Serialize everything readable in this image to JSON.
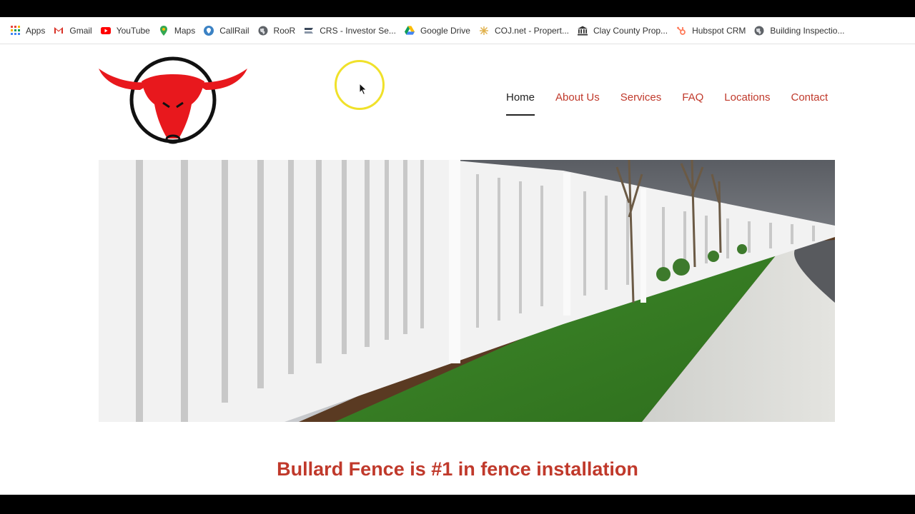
{
  "bookmarks": [
    {
      "label": "Apps",
      "icon": "apps-grid-icon"
    },
    {
      "label": "Gmail",
      "icon": "gmail-icon"
    },
    {
      "label": "YouTube",
      "icon": "youtube-icon"
    },
    {
      "label": "Maps",
      "icon": "maps-pin-icon"
    },
    {
      "label": "CallRail",
      "icon": "callrail-icon"
    },
    {
      "label": "RooR",
      "icon": "globe-icon"
    },
    {
      "label": "CRS - Investor Se...",
      "icon": "crs-icon"
    },
    {
      "label": "Google Drive",
      "icon": "google-drive-icon"
    },
    {
      "label": "COJ.net - Propert...",
      "icon": "coj-icon"
    },
    {
      "label": "Clay County Prop...",
      "icon": "building-icon"
    },
    {
      "label": "Hubspot CRM",
      "icon": "hubspot-icon"
    },
    {
      "label": "Building Inspectio...",
      "icon": "globe-icon"
    }
  ],
  "nav": {
    "items": [
      "Home",
      "About Us",
      "Services",
      "FAQ",
      "Locations",
      "Contact"
    ],
    "active": "Home"
  },
  "headline": "Bullard Fence is #1 in fence installation",
  "colors": {
    "brand_red": "#c0392b",
    "logo_red": "#e8181d",
    "cursor_highlight": "#f0e12a"
  }
}
